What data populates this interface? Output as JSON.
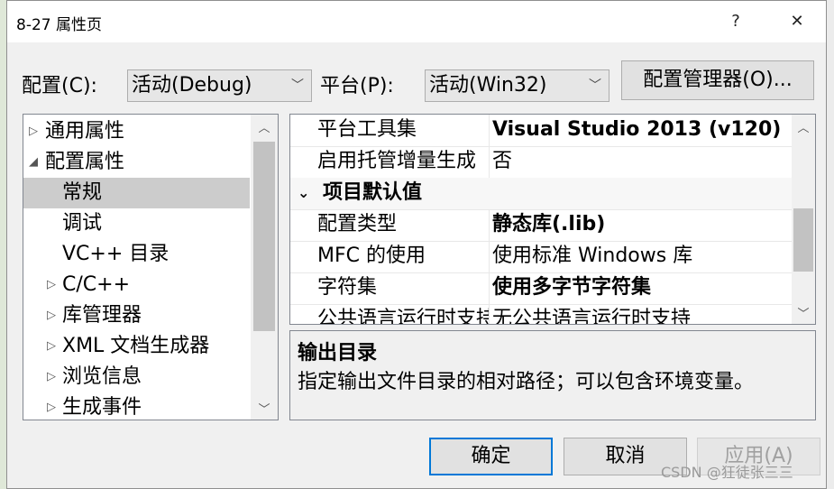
{
  "window": {
    "title": "8-27 属性页",
    "help_label": "?",
    "close_label": "✕"
  },
  "config_row": {
    "config_label": "配置(C):",
    "config_value": "活动(Debug)",
    "platform_label": "平台(P):",
    "platform_value": "活动(Win32)",
    "manager_button": "配置管理器(O)..."
  },
  "tree": {
    "items": [
      {
        "label": "通用属性",
        "expander": "▷",
        "level": 0
      },
      {
        "label": "配置属性",
        "expander": "◢",
        "level": 0
      },
      {
        "label": "常规",
        "expander": "",
        "level": 1,
        "selected": true
      },
      {
        "label": "调试",
        "expander": "",
        "level": 1
      },
      {
        "label": "VC++ 目录",
        "expander": "",
        "level": 1
      },
      {
        "label": "C/C++",
        "expander": "▷",
        "level": 1
      },
      {
        "label": "库管理器",
        "expander": "▷",
        "level": 1
      },
      {
        "label": "XML 文档生成器",
        "expander": "▷",
        "level": 1
      },
      {
        "label": "浏览信息",
        "expander": "▷",
        "level": 1
      },
      {
        "label": "生成事件",
        "expander": "▷",
        "level": 1
      }
    ]
  },
  "properties": {
    "rows": [
      {
        "name": "平台工具集",
        "value": "Visual Studio 2013 (v120)",
        "bold": true
      },
      {
        "name": "启用托管增量生成",
        "value": "否",
        "bold": false
      },
      {
        "category": "项目默认值",
        "toggle": "⌄"
      },
      {
        "name": "配置类型",
        "value": "静态库(.lib)",
        "bold": true
      },
      {
        "name": "MFC 的使用",
        "value": "使用标准 Windows 库",
        "bold": false
      },
      {
        "name": "字符集",
        "value": "使用多字节字符集",
        "bold": true
      },
      {
        "name": "公共语言运行时支持",
        "value": "无公共语言运行时支持",
        "bold": false
      }
    ]
  },
  "description": {
    "title": "输出目录",
    "text": "指定输出文件目录的相对路径；可以包含环境变量。"
  },
  "buttons": {
    "ok": "确定",
    "cancel": "取消",
    "apply": "应用(A)"
  },
  "watermark": "CSDN @狂徒张三三",
  "colors": {
    "accent": "#0078d7",
    "selected": "#cccccc",
    "dialog_bg": "#f0f0f0"
  }
}
